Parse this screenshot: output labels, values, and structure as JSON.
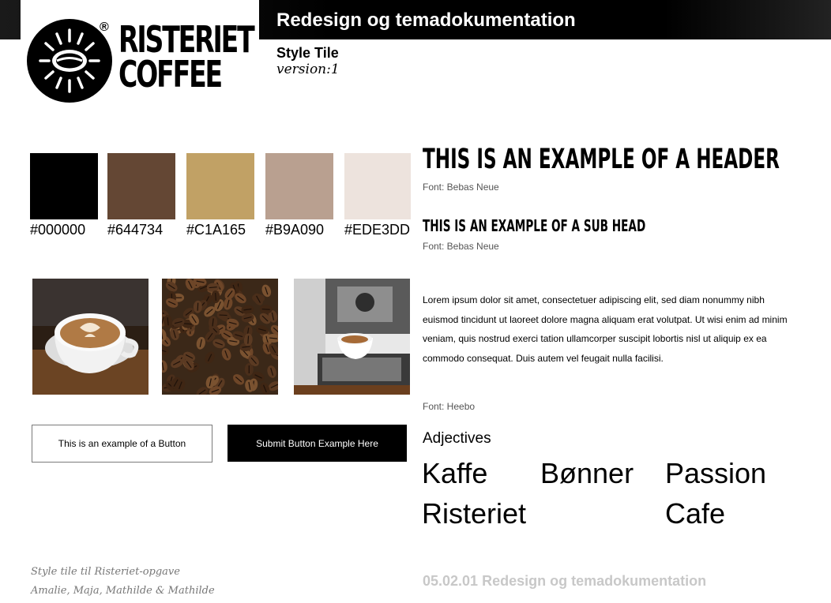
{
  "header": {
    "logo_text_line1": "RISTERIET",
    "logo_text_line2": "COFFEE",
    "logo_reg": "®",
    "title": "Redesign og temadokumentation",
    "subtitle": "Style Tile",
    "version": "version:1"
  },
  "palette": [
    {
      "hex": "#000000",
      "label": "#000000"
    },
    {
      "hex": "#644734",
      "label": "#644734"
    },
    {
      "hex": "#C1A165",
      "label": "#C1A165"
    },
    {
      "hex": "#B9A090",
      "label": "#B9A090"
    },
    {
      "hex": "#EDE3DD",
      "label": "#EDE3DD"
    }
  ],
  "photos": [
    "latte-cup-photo",
    "coffee-beans-photo",
    "espresso-machine-photo"
  ],
  "buttons": {
    "outline_label": "This is an example of a Button",
    "submit_label": "Submit Button Example Here"
  },
  "typography": {
    "header_example": "THIS IS AN EXAMPLE OF A HEADER",
    "header_font": "Font: Bebas Neue",
    "subhead_example": "THIS IS AN EXAMPLE OF A SUB HEAD",
    "subhead_font": "Font: Bebas Neue",
    "body_text": "Lorem ipsum dolor sit amet, consectetuer adipiscing elit, sed diam nonummy nibh euismod tincidunt ut laoreet dolore magna aliquam erat volutpat. Ut wisi enim ad minim veniam, quis nostrud exerci tation ullamcorper suscipit lobortis nisl ut aliquip ex ea commodo consequat. Duis autem vel feugait nulla facilisi.",
    "body_font": "Font: Heebo"
  },
  "adjectives": {
    "heading": "Adjectives",
    "words": [
      "Kaffe",
      "Bønner",
      "Passion",
      "Risteriet",
      "Cafe"
    ]
  },
  "footer": {
    "credit_line1": "Style tile til Risteriet-opgave",
    "credit_line2": "Amalie, Maja, Mathilde & Mathilde",
    "doc_title": "05.02.01 Redesign og temadokumentation"
  }
}
